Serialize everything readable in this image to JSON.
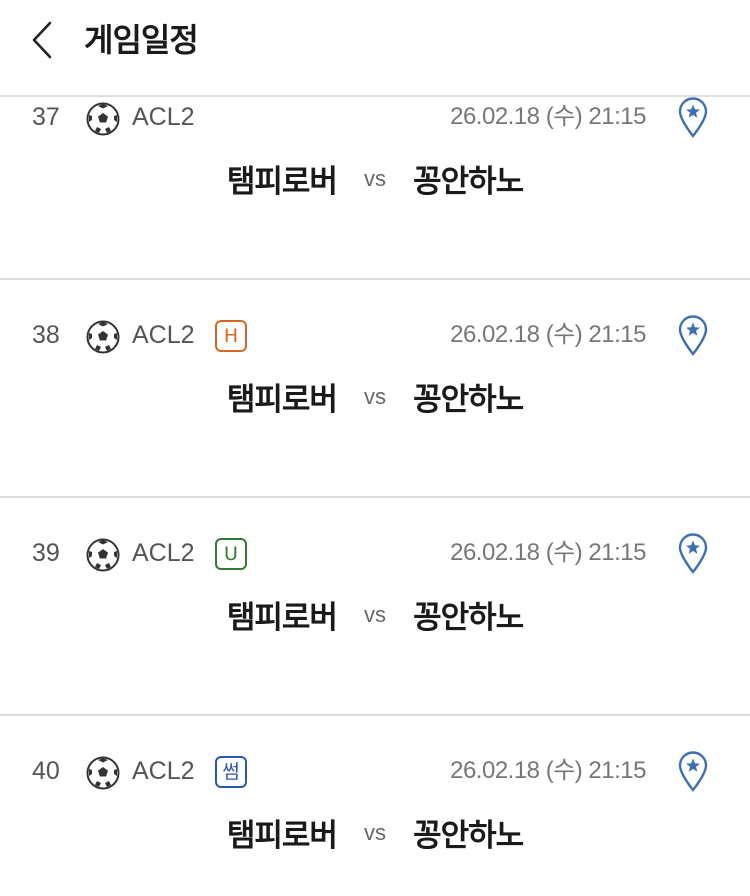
{
  "header": {
    "title": "게임일정",
    "back_icon": "chevron-left-icon"
  },
  "colors": {
    "badge_H": "#d4681e",
    "badge_U": "#2e7d32",
    "badge_O": "#2a56b4",
    "favorite": "#3d6fb5"
  },
  "games": [
    {
      "num": "37",
      "league": "ACL2",
      "badge": "",
      "badge_type": "",
      "datetime": "26.02.18 (수) 21:15",
      "home": "탬피로버",
      "vs": "vs",
      "away": "꽁안하노"
    },
    {
      "num": "38",
      "league": "ACL2",
      "badge": "H",
      "badge_type": "H",
      "datetime": "26.02.18 (수) 21:15",
      "home": "탬피로버",
      "vs": "vs",
      "away": "꽁안하노"
    },
    {
      "num": "39",
      "league": "ACL2",
      "badge": "U",
      "badge_type": "U",
      "datetime": "26.02.18 (수) 21:15",
      "home": "탬피로버",
      "vs": "vs",
      "away": "꽁안하노"
    },
    {
      "num": "40",
      "league": "ACL2",
      "badge": "썸",
      "badge_type": "O",
      "datetime": "26.02.18 (수) 21:15",
      "home": "탬피로버",
      "vs": "vs",
      "away": "꽁안하노"
    }
  ]
}
